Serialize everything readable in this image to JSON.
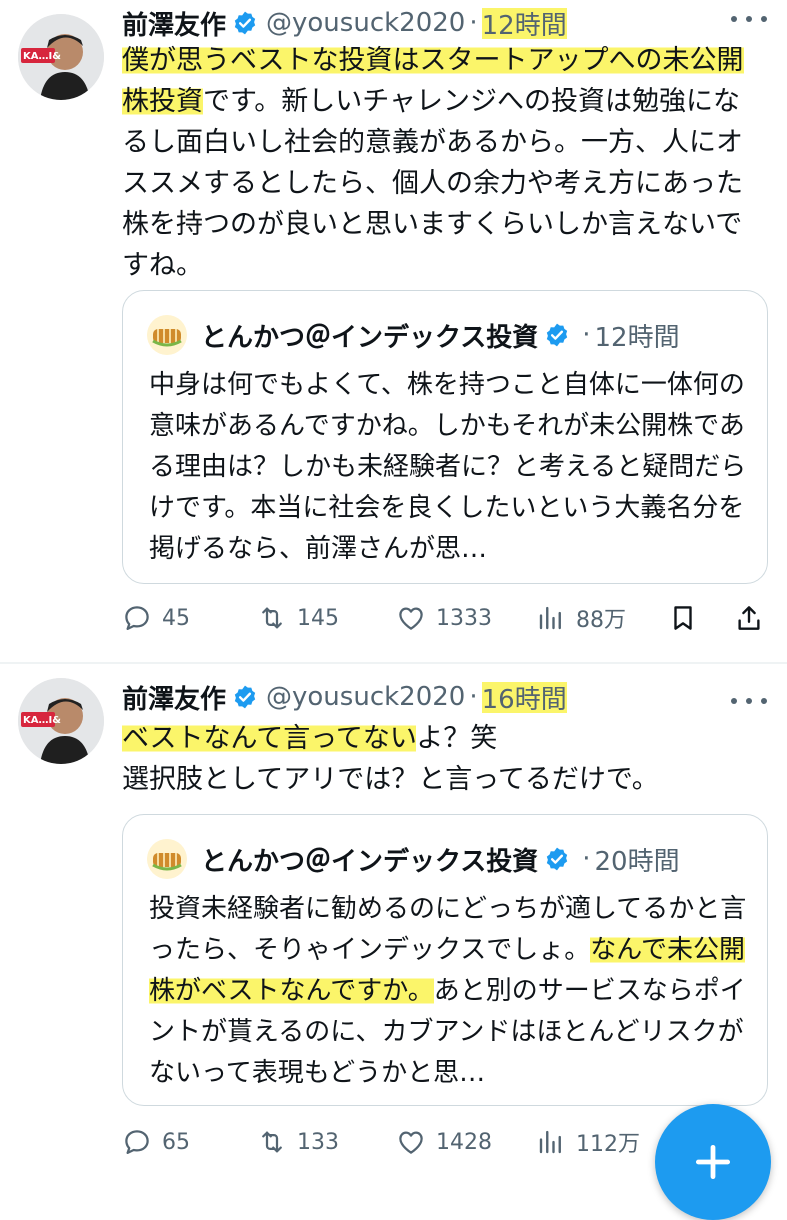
{
  "tweets": [
    {
      "author": {
        "name": "前澤友作",
        "handle": "@yousuck2020",
        "avatar_text": "KA…I&"
      },
      "time": "12時間",
      "body": {
        "hl1": "僕が思うベストな投資はスタートアップへの未公",
        "hl2": "開株投資",
        "rest": "です。新しいチャレンジへの投資は勉強になるし面白いし社会的意義があるから。一方、人にオススメするとしたら、個人の余力や考え方にあった株を持つのが良いと思いますくらいしか言えないですね。"
      },
      "quote": {
        "author": {
          "name": "とんかつ＠インデックス投資"
        },
        "time": "12時間",
        "text_plain": "中身は何でもよくて、株を持つこと自体に一体何の意味があるんですかね。しかもそれが未公開株である理由は？しかも未経験者に？と考えると疑問だらけです。本当に社会を良くしたいという大義名分を掲げるなら、前澤さんが思…"
      },
      "stats": {
        "replies": "45",
        "retweets": "145",
        "likes": "1333",
        "views": "88万"
      }
    },
    {
      "author": {
        "name": "前澤友作",
        "handle": "@yousuck2020",
        "avatar_text": "KA…I&"
      },
      "time": "16時間",
      "body": {
        "hl1": "ベストなんて言ってない",
        "rest": "よ？笑\n選択肢としてアリでは？と言ってるだけで。"
      },
      "quote": {
        "author": {
          "name": "とんかつ＠インデックス投資"
        },
        "time": "20時間",
        "text_a": "投資未経験者に勧めるのにどっちが適してるかと言ったら、そりゃインデックスでしょ。",
        "text_hl1": "なん",
        "text_hl2": "で未公開株がベストなんですか。",
        "text_b": "あと別のサービスならポイントが貰えるのに、カブアンドはほとんどリスクがないって表現もどうかと思…"
      },
      "stats": {
        "replies": "65",
        "retweets": "133",
        "likes": "1428",
        "views": "112万"
      }
    }
  ],
  "colors": {
    "accent": "#1d9bf0",
    "muted": "#536471",
    "highlight": "#fbf56a",
    "border": "#cfd9de"
  },
  "icons": [
    "verified-badge-icon",
    "more-dots-icon",
    "reply-icon",
    "retweet-icon",
    "like-icon",
    "views-icon",
    "bookmark-icon",
    "share-icon",
    "compose-plus-icon"
  ]
}
